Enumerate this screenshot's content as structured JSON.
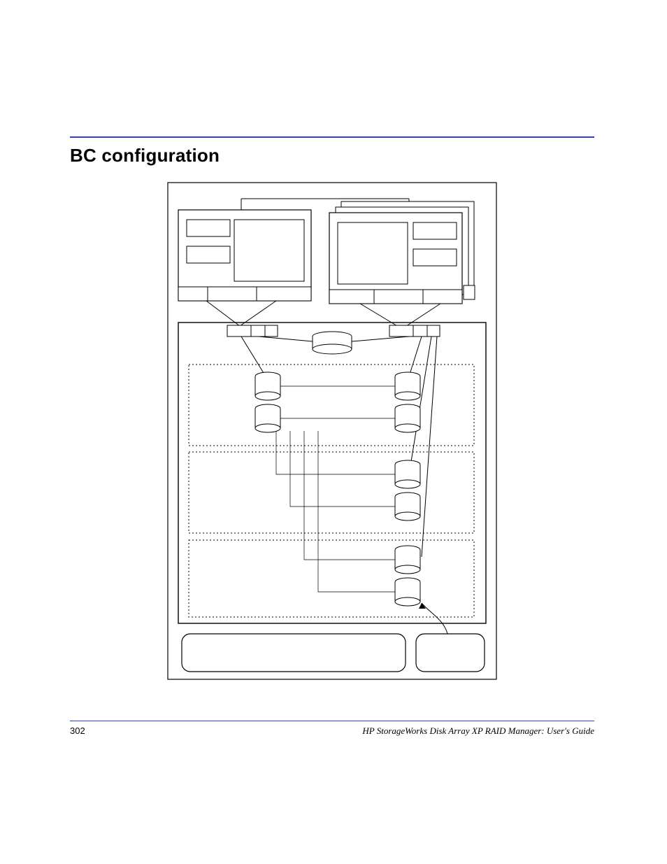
{
  "heading": "BC configuration",
  "page_number": "302",
  "footer_title": "HP StorageWorks Disk Array XP RAID Manager: User's Guide",
  "diagram": {
    "description": "BC configuration architecture diagram",
    "groups_count": 3
  }
}
